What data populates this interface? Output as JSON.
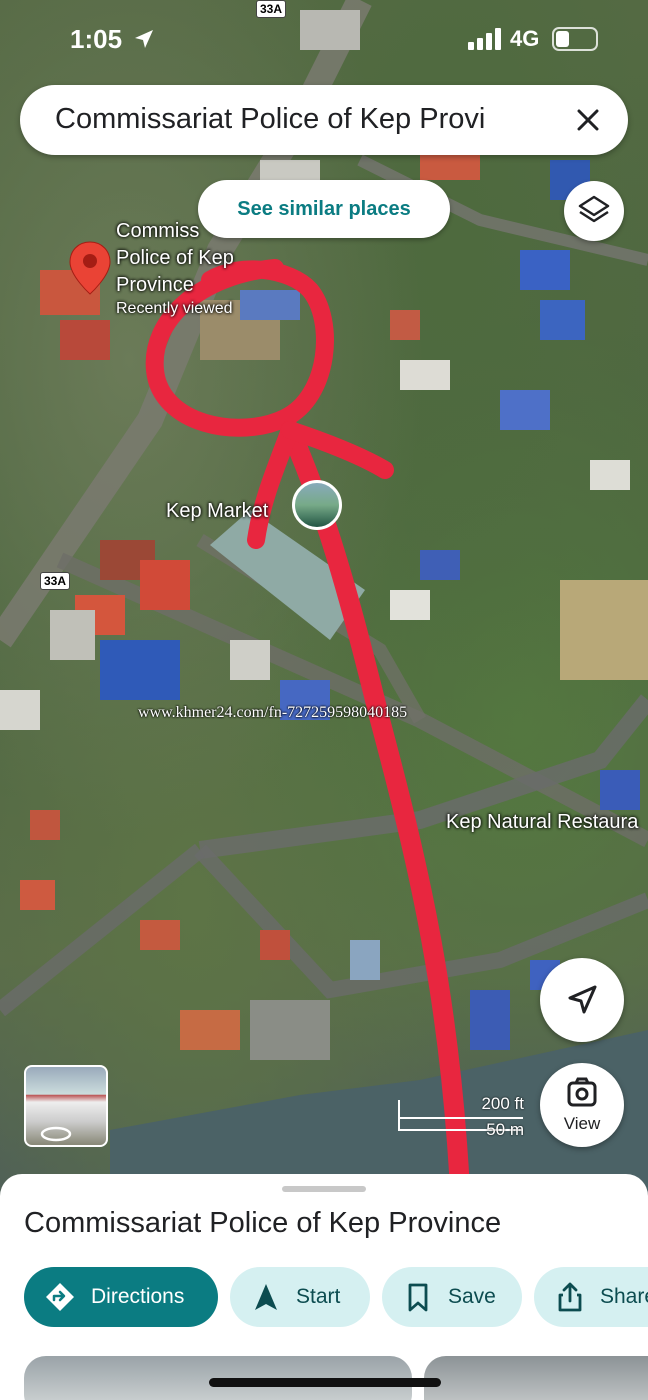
{
  "status_bar": {
    "time": "1:05",
    "network": "4G"
  },
  "search": {
    "query": "Commissariat Police of Kep Provi"
  },
  "map": {
    "see_similar_label": "See similar places",
    "pin_label": "Commissariat Police of Kep Province",
    "pin_label_line1": "Commiss",
    "pin_label_line2": "Police of Kep",
    "pin_label_line3": "Province",
    "pin_sublabel": "Recently viewed",
    "market_label": "Kep Market",
    "restaurant_label": "Kep Natural Restaura",
    "road_shield_1": "33A",
    "road_shield_2": "33A",
    "watermark": "www.khmer24.com/fn-727259598040185",
    "scale_ft": "200 ft",
    "scale_m": "50 m",
    "view_label": "View"
  },
  "place": {
    "title": "Commissariat Police of Kep Province",
    "actions": {
      "directions": "Directions",
      "start": "Start",
      "save": "Save",
      "share": "Share"
    }
  },
  "colors": {
    "accent": "#0b7c82",
    "chip_bg": "#d5f0f1",
    "annotation": "#e8263f",
    "pin": "#ea4335"
  }
}
